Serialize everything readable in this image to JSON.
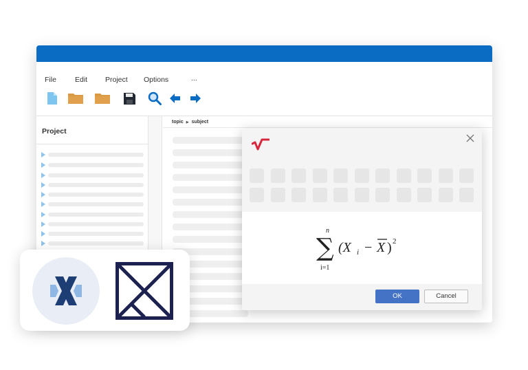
{
  "menu": {
    "file": "File",
    "edit": "Edit",
    "project": "Project",
    "options": "Options",
    "more": "..."
  },
  "toolbar": {
    "icons": [
      "new-file-icon",
      "open-folder-icon",
      "folder-icon",
      "save-icon",
      "search-icon",
      "back-arrow-icon",
      "forward-arrow-icon"
    ]
  },
  "sidebar": {
    "title": "Project"
  },
  "breadcrumb": {
    "first": "topic",
    "second": "subject"
  },
  "dialog": {
    "ok_label": "OK",
    "cancel_label": "Cancel",
    "formula": {
      "upper_limit": "n",
      "lower_limit": "i=1",
      "body_open": "(X",
      "subscript": "i",
      "minus": "−",
      "xbar": "X",
      "body_close": ")",
      "exponent": "2"
    }
  },
  "colors": {
    "titlebar": "#0b6cc4",
    "ok_button": "#4472c4",
    "accent_red": "#d6263d",
    "navy": "#1c2150"
  }
}
